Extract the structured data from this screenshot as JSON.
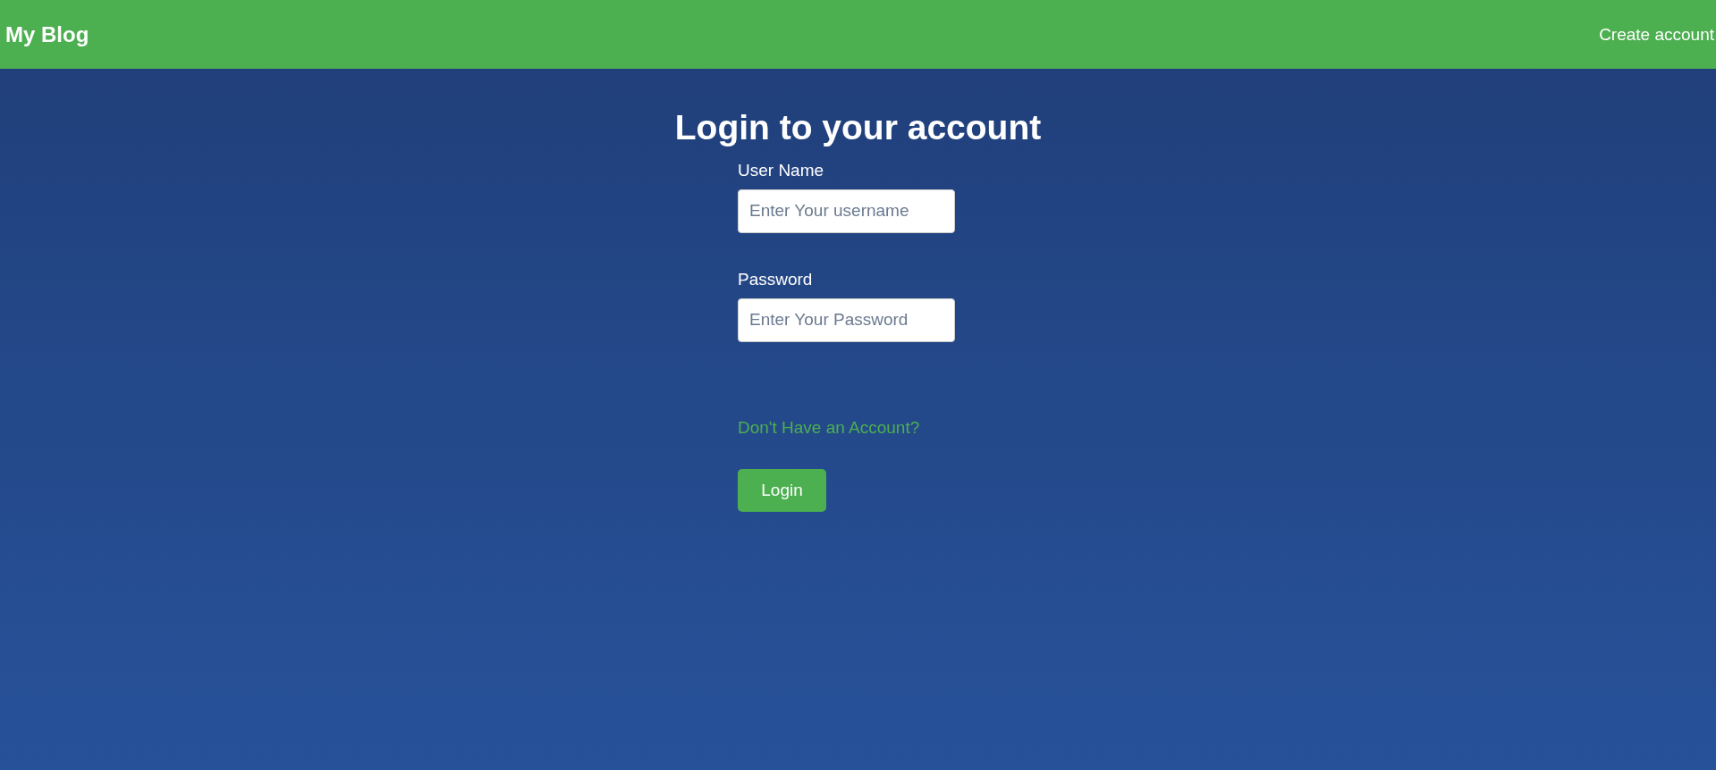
{
  "header": {
    "brand": "My Blog",
    "link": "Create account"
  },
  "title": "Login to your account",
  "fields": [
    {
      "label": "User Name",
      "placeholder": "Enter Your username"
    },
    {
      "label": "Password",
      "placeholder": "Enter Your Password"
    }
  ],
  "signup_link": "Don't Have an Account?",
  "submit": "Login"
}
